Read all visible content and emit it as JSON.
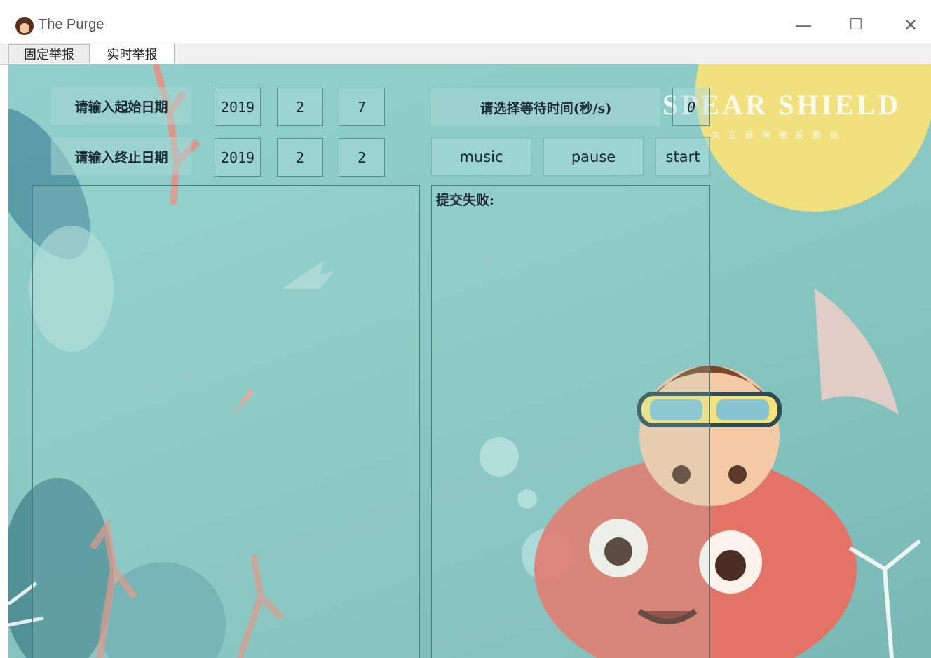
{
  "window": {
    "title": "The Purge",
    "minimize_glyph": "—",
    "maximize_glyph": "☐",
    "close_glyph": "✕"
  },
  "tabs": [
    {
      "label": "固定举报",
      "selected": false
    },
    {
      "label": "实时举报",
      "selected": true
    }
  ],
  "form": {
    "start_date_label": "请输入起始日期",
    "start_date": {
      "year": "2019",
      "month": "2",
      "day": "7"
    },
    "end_date_label": "请输入终止日期",
    "end_date": {
      "year": "2019",
      "month": "2",
      "day": "2"
    },
    "wait_time_label": "请选择等待时间(秒/s)",
    "wait_time_value": "0"
  },
  "buttons": {
    "music": "music",
    "pause": "pause",
    "start": "start"
  },
  "output": {
    "left_text": "",
    "right_label": "提交失败:"
  },
  "background": {
    "watermark_text": "SPEAR SHIELD",
    "watermark_subtitle": "朱正廷网络反黑站",
    "colors": {
      "sea": "#8fd0cc",
      "coral": "#f08a7a",
      "moon": "#f5e27a",
      "leaf": "#3f7f8a"
    }
  }
}
